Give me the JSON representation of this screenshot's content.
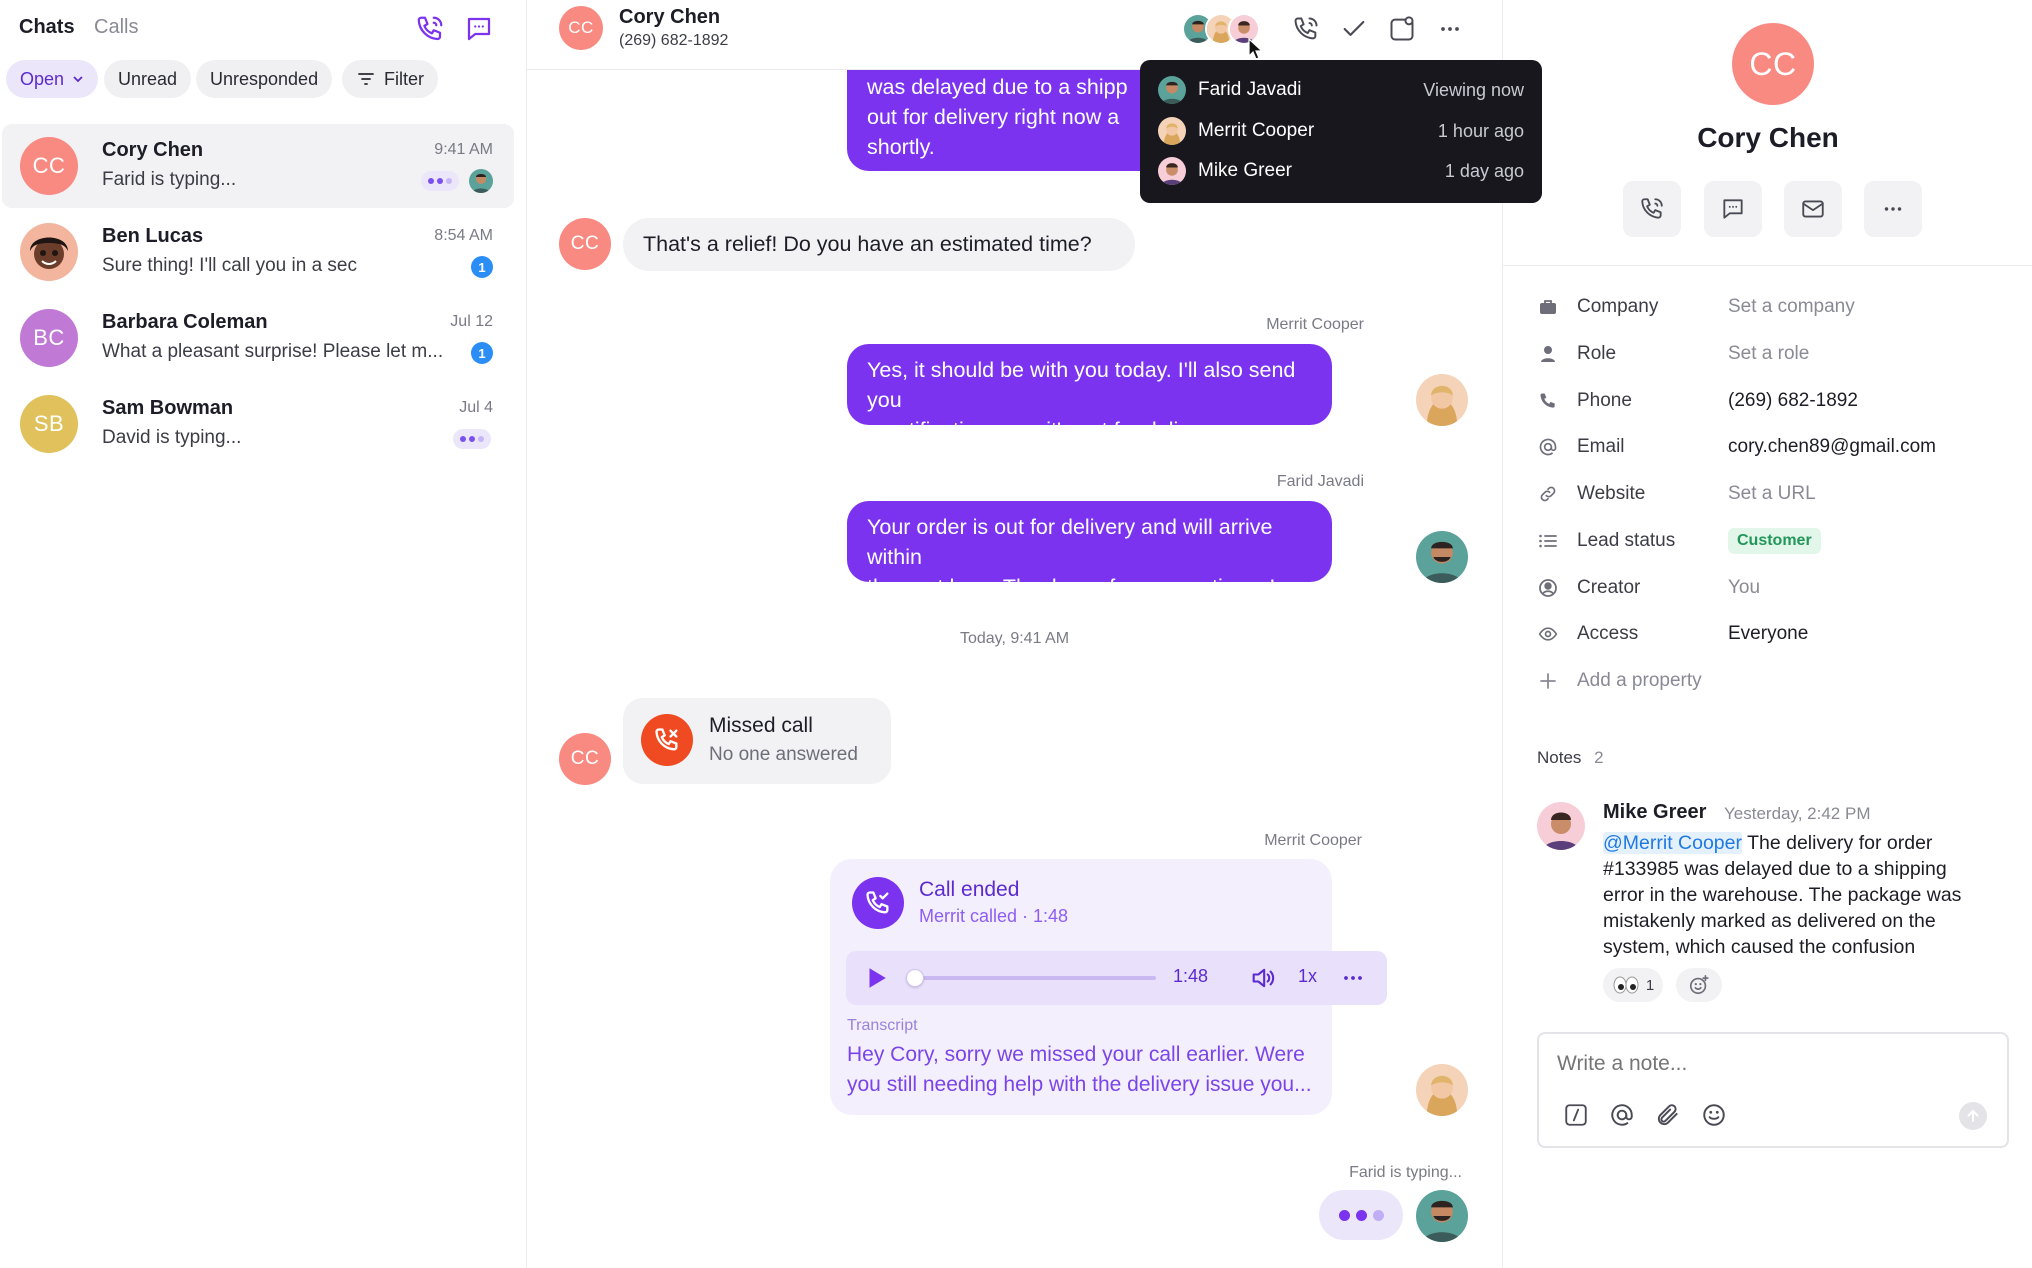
{
  "left": {
    "tabs": [
      "Chats",
      "Calls"
    ],
    "filters": {
      "status": "Open",
      "unread": "Unread",
      "unresponded": "Unresponded",
      "filter": "Filter"
    },
    "chats": [
      {
        "initials": "CC",
        "name": "Cory Chen",
        "preview": "Farid is typing...",
        "time": "9:41 AM",
        "color": "#f88a82"
      },
      {
        "initials": "",
        "name": "Ben Lucas",
        "preview": "Sure thing! I'll call you in a sec",
        "time": "8:54 AM",
        "badge": "1"
      },
      {
        "initials": "BC",
        "name": "Barbara Coleman",
        "preview": "What a pleasant surprise! Please let m...",
        "time": "Jul 12",
        "badge": "1",
        "color": "#c07ad6"
      },
      {
        "initials": "SB",
        "name": "Sam Bowman",
        "preview": "David is typing...",
        "time": "Jul 4",
        "color": "#e0c15c"
      }
    ]
  },
  "header": {
    "initials": "CC",
    "name": "Cory Chen",
    "phone": "(269) 682-1892"
  },
  "viewers": [
    {
      "name": "Farid Javadi",
      "time": "Viewing now"
    },
    {
      "name": "Merrit Cooper",
      "time": "1 hour ago"
    },
    {
      "name": "Mike Greer",
      "time": "1 day ago"
    }
  ],
  "messages": {
    "top_partial": [
      "was delayed due to a shipp",
      "out for delivery right now a",
      "shortly."
    ],
    "incoming_1": "That's a relief! Do you have an estimated time?",
    "sender_1": "Merrit Cooper",
    "outgoing_1": [
      "Yes, it should be with you today. I'll also send you",
      "a notification once it's out for delivery."
    ],
    "sender_2": "Farid Javadi",
    "outgoing_2": [
      "Your order is out for delivery and will arrive within",
      "the next hour. Thank you for your patience!"
    ],
    "divider": "Today, 9:41 AM",
    "missed_call": {
      "title": "Missed call",
      "subtitle": "No one answered"
    },
    "sender_3": "Merrit Cooper",
    "call_ended": {
      "title": "Call ended",
      "subtitle": "Merrit called · 1:48",
      "duration": "1:48",
      "speed": "1x",
      "progress": 0.0,
      "transcript_label": "Transcript",
      "transcript": [
        "Hey Cory, sorry we missed your call earlier. Were",
        "you still needing help with the delivery issue you..."
      ]
    },
    "typing": "Farid is typing..."
  },
  "contact": {
    "initials": "CC",
    "name": "Cory Chen",
    "properties": [
      {
        "label": "Company",
        "value": "Set a company",
        "muted": true
      },
      {
        "label": "Role",
        "value": "Set a role",
        "muted": true
      },
      {
        "label": "Phone",
        "value": "(269) 682-1892"
      },
      {
        "label": "Email",
        "value": "cory.chen89@gmail.com"
      },
      {
        "label": "Website",
        "value": "Set a URL",
        "muted": true
      },
      {
        "label": "Lead status",
        "value": "Customer"
      },
      {
        "label": "Creator",
        "value": "You",
        "muted": true
      },
      {
        "label": "Access",
        "value": "Everyone"
      }
    ],
    "add_property": "Add a property",
    "notes_label": "Notes",
    "notes_count": "2",
    "note": {
      "author": "Mike Greer",
      "time": "Yesterday, 2:42 PM",
      "mention": "@Merrit Cooper",
      "text_first": "The delivery for order",
      "text_lines": [
        "#133985 was delayed due to a shipping",
        "error in the warehouse. The package was",
        "mistakenly marked as delivered on the",
        "system, which caused the confusion"
      ],
      "reaction_count": "1"
    },
    "note_placeholder": "Write a note..."
  },
  "colors": {
    "accent": "#7b33f0",
    "coral": "#f88a82",
    "badge": "#2b8ef6",
    "missed": "#f04a22",
    "customer_bg": "#e2f6ea"
  }
}
